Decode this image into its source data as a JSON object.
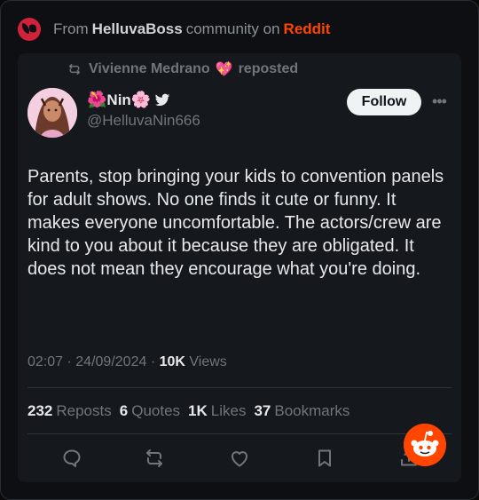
{
  "source": {
    "prefix": "From",
    "community": "HelluvaBoss",
    "middle": "community on",
    "platform": "Reddit"
  },
  "post": {
    "repost": {
      "reposter": "Vivienne Medrano",
      "emoji": "💖",
      "label": "reposted"
    },
    "author": {
      "emoji_left": "🌺",
      "display_name": "Nin",
      "emoji_right": "🌸",
      "handle": "@HelluvaNin666"
    },
    "follow_label": "Follow",
    "more_label": "•••",
    "text": "Parents, stop bringing your kids to convention panels for adult shows. No one finds it cute or funny. It makes everyone uncomfortable. The actors/crew are kind to you about it because they are obligated. It does not mean they encourage what you're doing.",
    "time": "02:07",
    "date": "24/09/2024",
    "sep": "·",
    "views_count": "10K",
    "views_label": "Views",
    "stats": {
      "reposts_count": "232",
      "reposts_label": "Reposts",
      "quotes_count": "6",
      "quotes_label": "Quotes",
      "likes_count": "1K",
      "likes_label": "Likes",
      "bookmarks_count": "37",
      "bookmarks_label": "Bookmarks"
    },
    "actions": [
      "reply-icon",
      "repost-icon",
      "like-icon",
      "bookmark-icon",
      "share-icon"
    ]
  },
  "colors": {
    "reddit": "#ff4500",
    "helluva_logo": "#d1223c",
    "card_bg": "#15181c",
    "muted": "#71767b"
  }
}
